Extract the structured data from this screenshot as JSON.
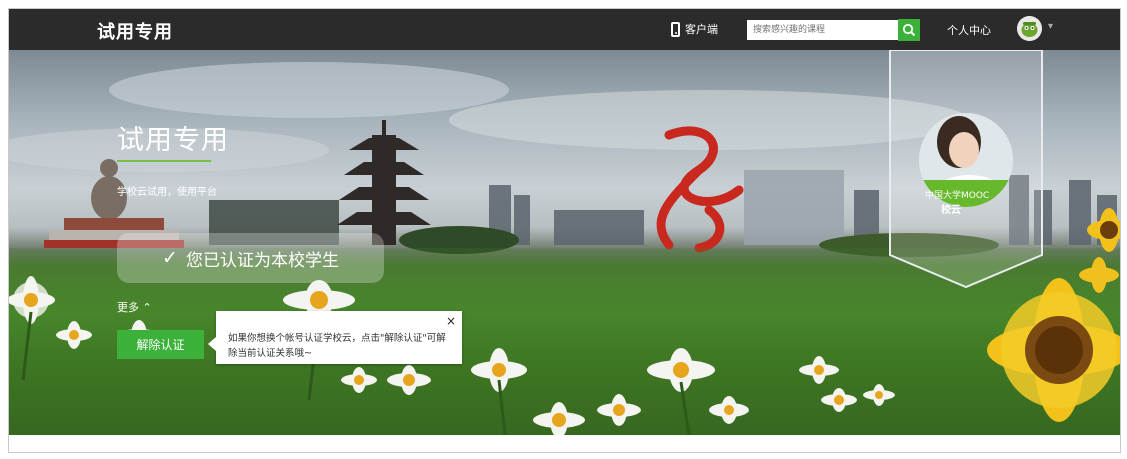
{
  "topbar": {
    "brand": "试用专用",
    "client_label": "客户端",
    "search_placeholder": "搜索感兴趣的课程",
    "personal_center": "个人中心",
    "icons": {
      "phone": "phone-icon",
      "search": "search-icon",
      "avatar": "user-avatar",
      "caret": "caret-down-icon"
    }
  },
  "hero": {
    "title": "试用专用",
    "subtitle": "学校云试用，使用平台",
    "verified_text": "您已认证为本校学生",
    "more_label": "更多",
    "unbind_label": "解除认证",
    "tooltip_text": "如果你想换个帐号认证学校云，点击\"解除认证\"可解除当前认证关系哦~",
    "tooltip_close": "×",
    "badge_tag": "中国大学MOOC",
    "badge_name": "校云"
  },
  "colors": {
    "accent": "#3cb13a",
    "topbar_bg": "#2b2b2b",
    "underline": "#7bc043"
  }
}
